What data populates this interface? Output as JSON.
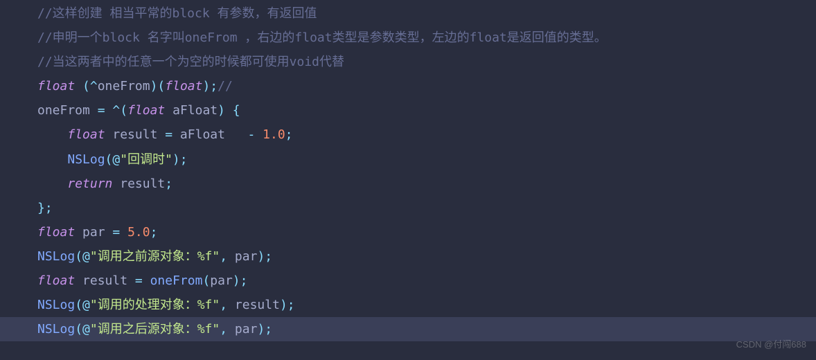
{
  "code": {
    "lines": [
      {
        "tokens": [
          {
            "cls": "comment",
            "text": "//这样创建 相当平常的block 有参数，有返回值"
          }
        ]
      },
      {
        "tokens": [
          {
            "cls": "comment",
            "text": "//申明一个block 名字叫oneFrom ，右边的float类型是参数类型，左边的float是返回值的类型。"
          }
        ]
      },
      {
        "tokens": [
          {
            "cls": "comment",
            "text": "//当这两者中的任意一个为空的时候都可使用void代替"
          }
        ]
      },
      {
        "tokens": [
          {
            "cls": "type",
            "text": "float"
          },
          {
            "cls": "default",
            "text": " "
          },
          {
            "cls": "punct",
            "text": "("
          },
          {
            "cls": "caret",
            "text": "^"
          },
          {
            "cls": "default",
            "text": "oneFrom"
          },
          {
            "cls": "punct",
            "text": ")("
          },
          {
            "cls": "type",
            "text": "float"
          },
          {
            "cls": "punct",
            "text": ");"
          },
          {
            "cls": "comment",
            "text": "//"
          }
        ]
      },
      {
        "tokens": [
          {
            "cls": "default",
            "text": "oneFrom "
          },
          {
            "cls": "operator",
            "text": "="
          },
          {
            "cls": "default",
            "text": " "
          },
          {
            "cls": "caret",
            "text": "^"
          },
          {
            "cls": "punct",
            "text": "("
          },
          {
            "cls": "type",
            "text": "float"
          },
          {
            "cls": "default",
            "text": " aFloat"
          },
          {
            "cls": "punct",
            "text": ") {"
          }
        ]
      },
      {
        "tokens": [
          {
            "cls": "default",
            "text": "    "
          },
          {
            "cls": "type",
            "text": "float"
          },
          {
            "cls": "default",
            "text": " result "
          },
          {
            "cls": "operator",
            "text": "="
          },
          {
            "cls": "default",
            "text": " aFloat   "
          },
          {
            "cls": "operator",
            "text": "-"
          },
          {
            "cls": "default",
            "text": " "
          },
          {
            "cls": "number",
            "text": "1.0"
          },
          {
            "cls": "punct",
            "text": ";"
          }
        ]
      },
      {
        "tokens": [
          {
            "cls": "default",
            "text": "    "
          },
          {
            "cls": "func",
            "text": "NSLog"
          },
          {
            "cls": "punct",
            "text": "("
          },
          {
            "cls": "at",
            "text": "@"
          },
          {
            "cls": "string",
            "text": "\"回调时\""
          },
          {
            "cls": "punct",
            "text": ");"
          }
        ]
      },
      {
        "tokens": [
          {
            "cls": "default",
            "text": "    "
          },
          {
            "cls": "keyword",
            "text": "return"
          },
          {
            "cls": "default",
            "text": " result"
          },
          {
            "cls": "punct",
            "text": ";"
          }
        ]
      },
      {
        "tokens": [
          {
            "cls": "punct",
            "text": "};"
          }
        ]
      },
      {
        "tokens": [
          {
            "cls": "type",
            "text": "float"
          },
          {
            "cls": "default",
            "text": " par "
          },
          {
            "cls": "operator",
            "text": "="
          },
          {
            "cls": "default",
            "text": " "
          },
          {
            "cls": "number",
            "text": "5.0"
          },
          {
            "cls": "punct",
            "text": ";"
          }
        ]
      },
      {
        "tokens": [
          {
            "cls": "func",
            "text": "NSLog"
          },
          {
            "cls": "punct",
            "text": "("
          },
          {
            "cls": "at",
            "text": "@"
          },
          {
            "cls": "string",
            "text": "\"调用之前源对象：%f\""
          },
          {
            "cls": "punct",
            "text": ","
          },
          {
            "cls": "default",
            "text": " par"
          },
          {
            "cls": "punct",
            "text": ");"
          }
        ]
      },
      {
        "tokens": [
          {
            "cls": "type",
            "text": "float"
          },
          {
            "cls": "default",
            "text": " result "
          },
          {
            "cls": "operator",
            "text": "="
          },
          {
            "cls": "default",
            "text": " "
          },
          {
            "cls": "func",
            "text": "oneFrom"
          },
          {
            "cls": "punct",
            "text": "("
          },
          {
            "cls": "default",
            "text": "par"
          },
          {
            "cls": "punct",
            "text": ");"
          }
        ]
      },
      {
        "tokens": [
          {
            "cls": "func",
            "text": "NSLog"
          },
          {
            "cls": "punct",
            "text": "("
          },
          {
            "cls": "at",
            "text": "@"
          },
          {
            "cls": "string",
            "text": "\"调用的处理对象：%f\""
          },
          {
            "cls": "punct",
            "text": ","
          },
          {
            "cls": "default",
            "text": " result"
          },
          {
            "cls": "punct",
            "text": ");"
          }
        ]
      },
      {
        "highlight": true,
        "tokens": [
          {
            "cls": "func",
            "text": "NSLog"
          },
          {
            "cls": "punct",
            "text": "("
          },
          {
            "cls": "at",
            "text": "@"
          },
          {
            "cls": "string",
            "text": "\"调用之后源对象：%f\""
          },
          {
            "cls": "punct",
            "text": ","
          },
          {
            "cls": "default",
            "text": " par"
          },
          {
            "cls": "punct",
            "text": ");"
          }
        ]
      }
    ]
  },
  "watermark": "CSDN @付闯688"
}
